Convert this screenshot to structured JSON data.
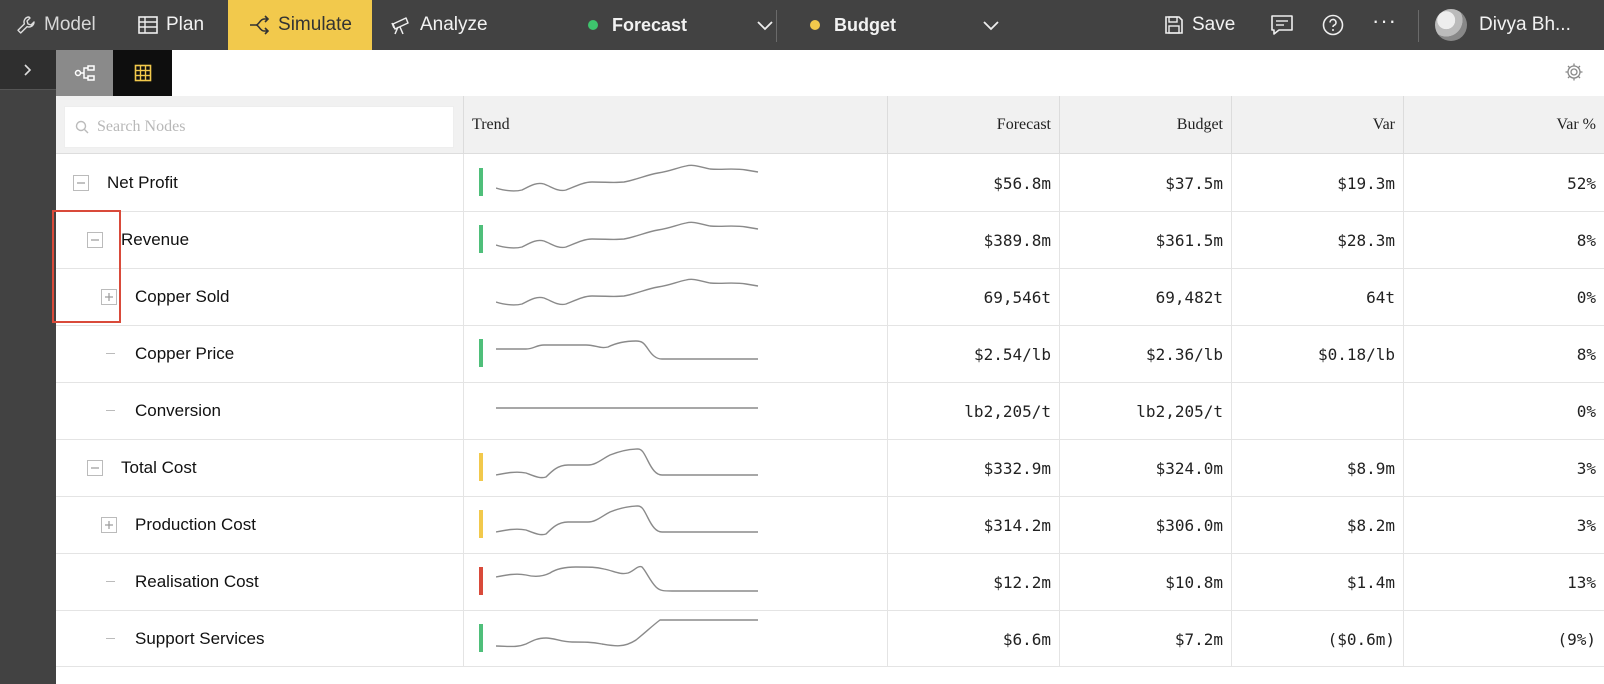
{
  "nav": {
    "model": "Model",
    "plan": "Plan",
    "simulate": "Simulate",
    "analyze": "Analyze"
  },
  "scenarios": {
    "forecast": {
      "label": "Forecast",
      "color": "#3ec46d"
    },
    "budget": {
      "label": "Budget",
      "color": "#f2c94c"
    }
  },
  "actions": {
    "save": "Save",
    "more": "···",
    "user": "Divya Bh..."
  },
  "search": {
    "placeholder": "Search Nodes"
  },
  "columns": {
    "trend": "Trend",
    "forecast": "Forecast",
    "budget": "Budget",
    "var": "Var",
    "var_pct": "Var %"
  },
  "status_colors": {
    "green": "#4fbf7a",
    "yellow": "#f2c94c",
    "red": "#d94a3a"
  },
  "rows": [
    {
      "name": "Net Profit",
      "indent": 0,
      "toggle": "collapse",
      "status": "green",
      "trend": "a",
      "forecast": "$56.8m",
      "budget": "$37.5m",
      "var": "$19.3m",
      "var_pct": "52%"
    },
    {
      "name": "Revenue",
      "indent": 1,
      "toggle": "collapse",
      "status": "green",
      "trend": "a",
      "forecast": "$389.8m",
      "budget": "$361.5m",
      "var": "$28.3m",
      "var_pct": "8%"
    },
    {
      "name": "Copper Sold",
      "indent": 2,
      "toggle": "expand",
      "status": "",
      "trend": "a",
      "forecast": "69,546t",
      "budget": "69,482t",
      "var": "64t",
      "var_pct": "0%"
    },
    {
      "name": "Copper Price",
      "indent": 2,
      "toggle": "leaf",
      "status": "green",
      "trend": "b",
      "forecast": "$2.54/lb",
      "budget": "$2.36/lb",
      "var": "$0.18/lb",
      "var_pct": "8%"
    },
    {
      "name": "Conversion",
      "indent": 2,
      "toggle": "leaf",
      "status": "",
      "trend": "flat",
      "forecast": "lb2,205/t",
      "budget": "lb2,205/t",
      "var": "",
      "var_pct": "0%"
    },
    {
      "name": "Total Cost",
      "indent": 1,
      "toggle": "collapse",
      "status": "yellow",
      "trend": "c",
      "forecast": "$332.9m",
      "budget": "$324.0m",
      "var": "$8.9m",
      "var_pct": "3%"
    },
    {
      "name": "Production Cost",
      "indent": 2,
      "toggle": "expand",
      "status": "yellow",
      "trend": "c",
      "forecast": "$314.2m",
      "budget": "$306.0m",
      "var": "$8.2m",
      "var_pct": "3%"
    },
    {
      "name": "Realisation Cost",
      "indent": 2,
      "toggle": "leaf",
      "status": "red",
      "trend": "d",
      "forecast": "$12.2m",
      "budget": "$10.8m",
      "var": "$1.4m",
      "var_pct": "13%"
    },
    {
      "name": "Support Services",
      "indent": 2,
      "toggle": "leaf",
      "status": "green",
      "trend": "e",
      "forecast": "$6.6m",
      "budget": "$7.2m",
      "var": "($0.6m)",
      "var_pct": "(9%)"
    }
  ]
}
